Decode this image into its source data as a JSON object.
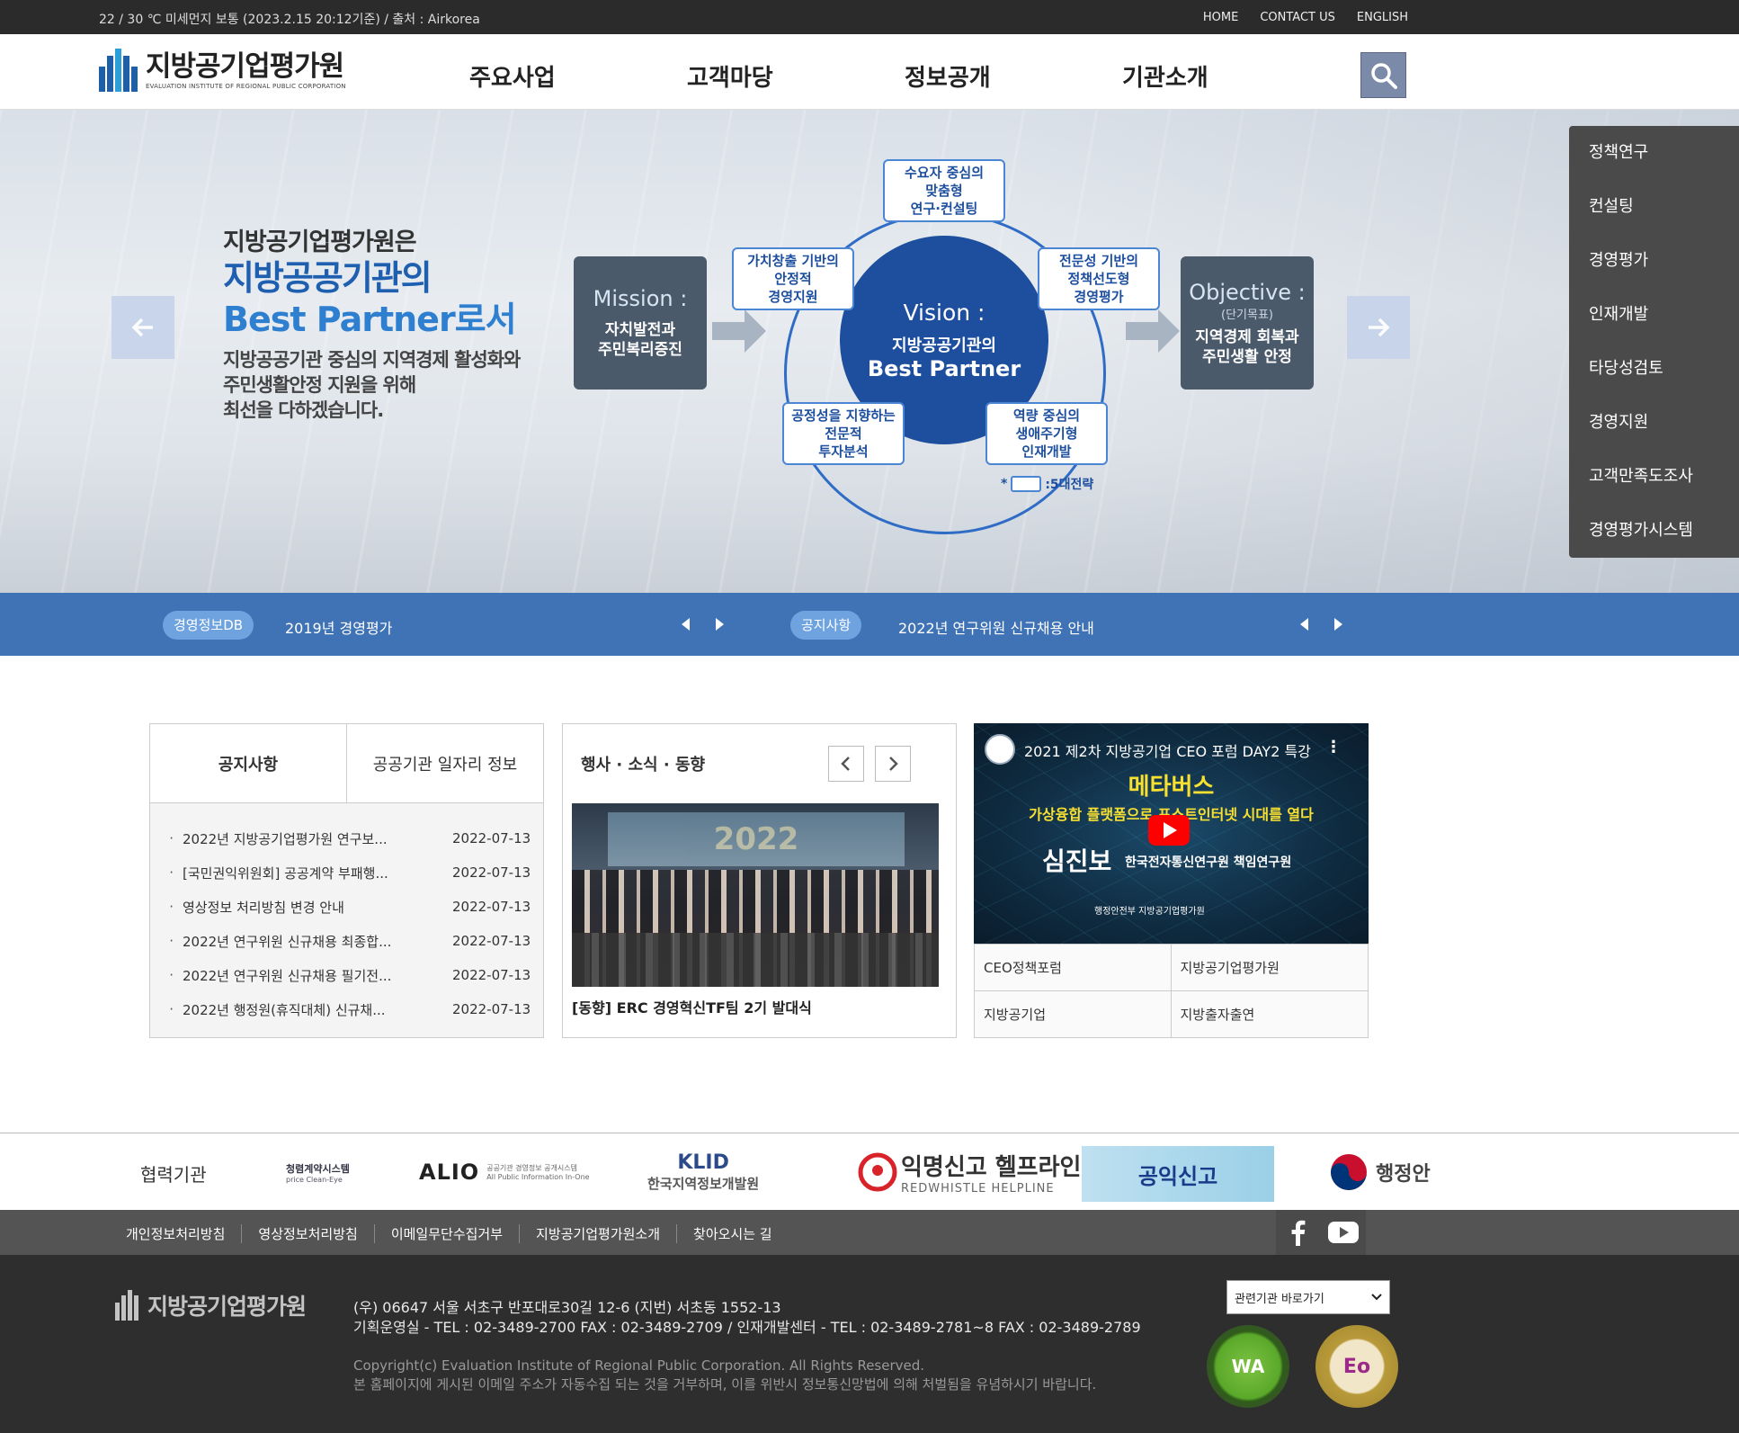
{
  "topbar": {
    "weather": "22 / 30 ℃   미세먼지 보통  (2023.2.15 20:12기준) / 출처 : Airkorea",
    "links": [
      "HOME",
      "CONTACT US",
      "ENGLISH"
    ]
  },
  "header": {
    "logo_ko": "지방공기업평가원",
    "logo_en": "EVALUATION INSTITUTE OF REGIONAL PUBLIC CORPORATION",
    "nav": [
      "주요사업",
      "고객마당",
      "정보공개",
      "기관소개"
    ]
  },
  "hero": {
    "line1": "지방공기업평가원은",
    "line2": "지방공공기관의",
    "line3": "Best Partner로서",
    "line4a": "지방공공기관 중심의 지역경제 활성화와",
    "line4b": "주민생활안정 지원을 위해",
    "line4c": "최선을 다하겠습니다.",
    "mission_title": "Mission :",
    "mission_desc1": "자치발전과",
    "mission_desc2": "주민복리증진",
    "vision_title": "Vision :",
    "vision_desc1": "지방공공기관의",
    "vision_desc2": "Best Partner",
    "objective_title": "Objective :",
    "objective_sub": "(단기목표)",
    "objective_desc1": "지역경제 회복과",
    "objective_desc2": "주민생활 안정",
    "strategies": [
      {
        "l1": "수요자 중심의",
        "l2": "맞춤형",
        "l3": "연구·컨설팅"
      },
      {
        "l1": "가치창출 기반의",
        "l2": "안정적",
        "l3": "경영지원"
      },
      {
        "l1": "전문성 기반의",
        "l2": "정책선도형",
        "l3": "경영평가"
      },
      {
        "l1": "공정성을 지향하는",
        "l2": "전문적",
        "l3": "투자분석"
      },
      {
        "l1": "역량 중심의",
        "l2": "생애주기형",
        "l3": "인재개발"
      }
    ],
    "legend": ":5대전략"
  },
  "quick_menu": [
    "정책연구",
    "컨설팅",
    "경영평가",
    "인재개발",
    "타당성검토",
    "경영지원",
    "고객만족도조사",
    "경영평가시스템"
  ],
  "ticker": {
    "left_badge": "경영정보DB",
    "left_text": "2019년 경영평가",
    "right_badge": "공지사항",
    "right_text": "2022년 연구위원 신규채용 안내"
  },
  "notice_panel": {
    "tab_active": "공지사항",
    "tab_other": "공공기관 일자리 정보",
    "rows": [
      {
        "title": "2022년 지방공기업평가원 연구보...",
        "date": "2022-07-13"
      },
      {
        "title": "[국민권익위원회] 공공계약 부패행...",
        "date": "2022-07-13"
      },
      {
        "title": "영상정보 처리방침 변경 안내",
        "date": "2022-07-13"
      },
      {
        "title": "2022년 연구위원 신규채용 최종합...",
        "date": "2022-07-13"
      },
      {
        "title": "2022년 연구위원 신규채용 필기전...",
        "date": "2022-07-13"
      },
      {
        "title": "2022년 행정원(휴직대체) 신규채...",
        "date": "2022-07-13"
      }
    ]
  },
  "news_panel": {
    "title": "행사 · 소식 · 동향",
    "photo_banner": "2022",
    "caption": "[동향] ERC 경영혁신TF팀 2기 발대식"
  },
  "video_panel": {
    "title": "2021 제2차 지방공기업 CEO 포럼 DAY2 특강",
    "headline": "메타버스",
    "subline": "가상융합 플랫폼으로 포스트인터넷 시대를 열다",
    "speaker": "심진보",
    "org": "한국전자통신연구원 책임연구원",
    "foot": "행정안전부    지방공기업평가원",
    "menu": "⋮",
    "links": [
      "CEO정책포럼",
      "지방공기업평가원",
      "지방공기업",
      "지방출자출연"
    ]
  },
  "partners": {
    "title": "협력기관",
    "items": [
      "청렴계약시스템",
      "ALIO",
      "KLID",
      "익명신고 헬프라인",
      "공익신고",
      "행정안"
    ],
    "cleaneye_sub": "price Clean-Eye",
    "alio_sub1": "공공기관 경영정보 공개시스템",
    "alio_sub2": "All Public Information In-One",
    "klid_sub": "한국지역정보개발원",
    "helpline_sub": "REDWHISTLE HELPLINE"
  },
  "footer": {
    "links": [
      "개인정보처리방침",
      "영상정보처리방침",
      "이메일무단수집거부",
      "지방공기업평가원소개",
      "찾아오시는 길"
    ],
    "logo_ko": "지방공기업평가원",
    "address": "(우) 06647 서울 서초구 반포대로30길 12-6 (지번) 서초동 1552-13",
    "phone": "기획운영실 - TEL : 02-3489-2700 FAX : 02-3489-2709 / 인재개발센터 - TEL : 02-3489-2781~8 FAX : 02-3489-2789",
    "copyright": "Copyright(c) Evaluation Institute of Regional Public Corporation. All Rights Reserved.",
    "email_notice": "본 홈페이지에 게시된 이메일 주소가 자동수집 되는 것을 거부하며, 이를 위반시 정보통신망법에 의해 처벌됨을 유념하시기 바랍니다.",
    "select_label": "관련기관 바로가기",
    "cert1": "WA",
    "cert2": "Eo"
  }
}
